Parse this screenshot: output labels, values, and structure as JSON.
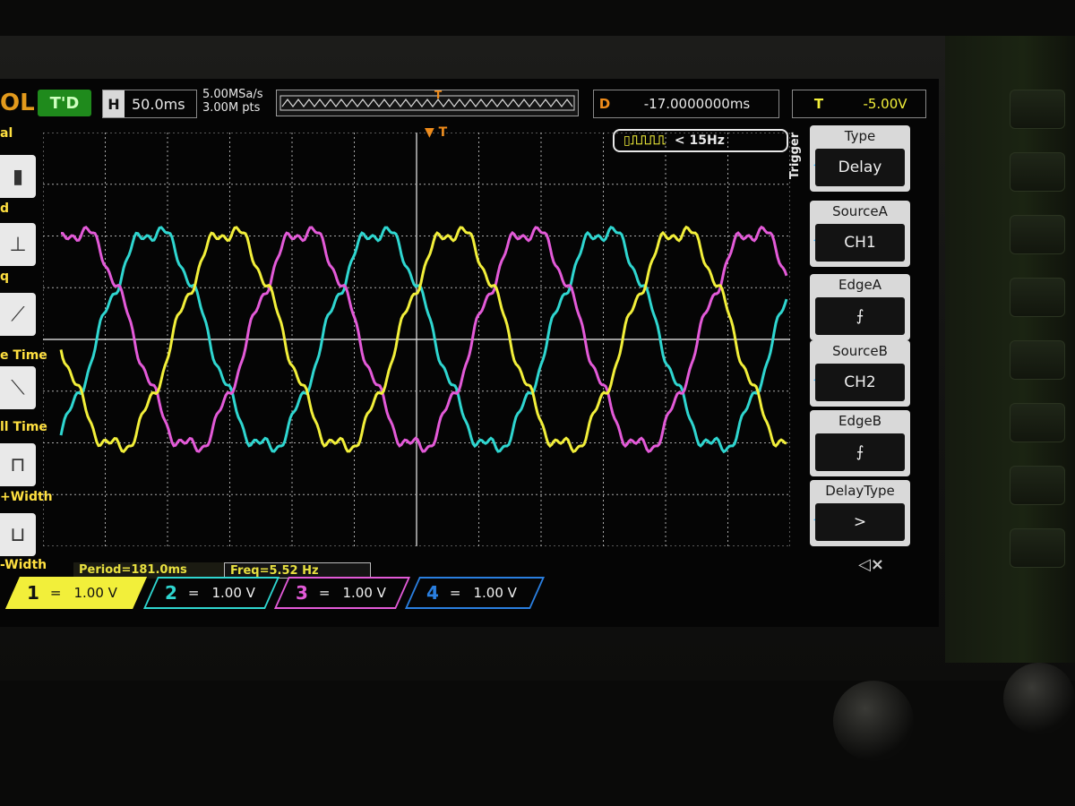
{
  "brand": "OL",
  "trigger_state": "T'D",
  "timebase": {
    "key": "H",
    "value": "50.0ms"
  },
  "sampling": {
    "rate": "5.00MSa/s",
    "points": "3.00M pts"
  },
  "delay": {
    "key": "D",
    "value": "-17.0000000ms"
  },
  "trigger_level": {
    "key": "T",
    "value": "-5.00V"
  },
  "trigger_freq": "< 15Hz",
  "left_menu": [
    {
      "label": "al",
      "icon": "waveform-cursor-icon"
    },
    {
      "label": "d",
      "icon": "delay-icon"
    },
    {
      "label": "q",
      "icon": "slope-icon"
    },
    {
      "label": "e Time",
      "icon": "rise-time-icon"
    },
    {
      "label": "ll Time",
      "icon": "fall-time-icon"
    },
    {
      "label": "+Width",
      "icon": "positive-width-icon"
    },
    {
      "label": "-Width",
      "icon": "negative-width-icon"
    }
  ],
  "trigger_menu": {
    "title": "Trigger",
    "items": [
      {
        "header": "Type",
        "value": "Delay"
      },
      {
        "header": "SourceA",
        "value": "CH1"
      },
      {
        "header": "EdgeA",
        "value": "⨍"
      },
      {
        "header": "SourceB",
        "value": "CH2"
      },
      {
        "header": "EdgeB",
        "value": "⨍"
      },
      {
        "header": "DelayType",
        "value": ">"
      }
    ]
  },
  "measurements": {
    "period": "Period=181.0ms",
    "freq": "Freq=5.52 Hz"
  },
  "channels": [
    {
      "num": "1",
      "coupling": "=",
      "scale": "1.00 V",
      "color": "#f2ef3a"
    },
    {
      "num": "2",
      "coupling": "=",
      "scale": "1.00 V",
      "color": "#2fd6d0"
    },
    {
      "num": "3",
      "coupling": "=",
      "scale": "1.00 V",
      "color": "#e35ad8"
    },
    {
      "num": "4",
      "coupling": "=",
      "scale": "1.00 V",
      "color": "#2a7fe0"
    }
  ],
  "colors": {
    "ch1": "#f2ef3a",
    "ch2": "#2fd6d0",
    "ch3": "#e35ad8",
    "trigger": "#f08c1a"
  }
}
